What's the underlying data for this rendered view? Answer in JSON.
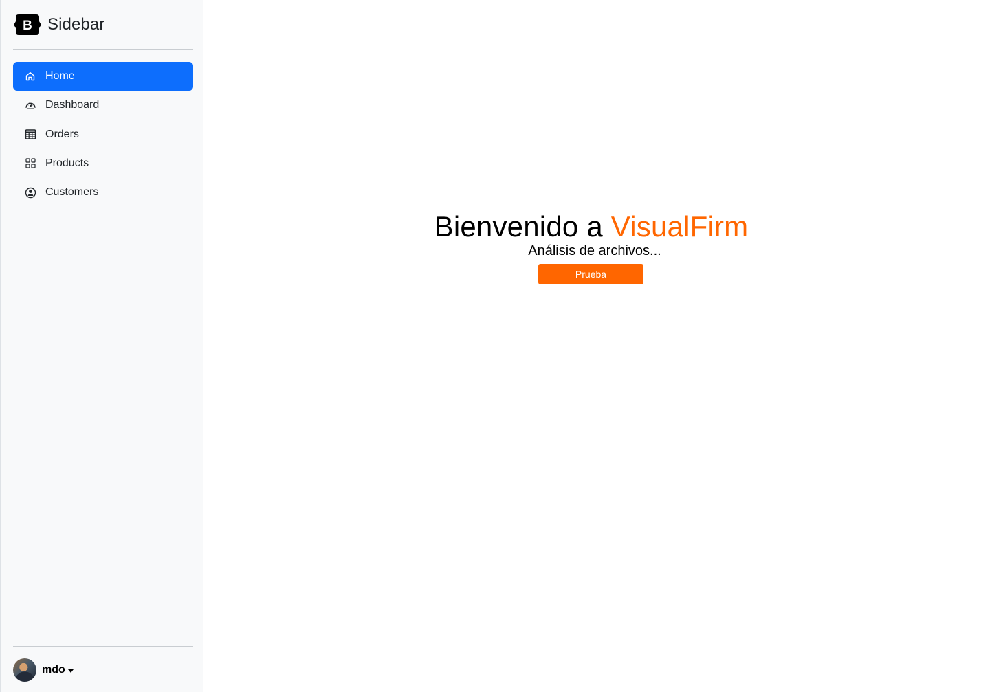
{
  "sidebar": {
    "brand": {
      "logo_letter": "B",
      "title": "Sidebar"
    },
    "items": [
      {
        "label": "Home",
        "icon": "home-icon",
        "active": true
      },
      {
        "label": "Dashboard",
        "icon": "speedometer-icon",
        "active": false
      },
      {
        "label": "Orders",
        "icon": "table-icon",
        "active": false
      },
      {
        "label": "Products",
        "icon": "grid-icon",
        "active": false
      },
      {
        "label": "Customers",
        "icon": "person-circle-icon",
        "active": false
      }
    ],
    "user": {
      "name": "mdo",
      "avatar": "user-avatar",
      "dropdown_icon": "caret-down-icon"
    }
  },
  "main": {
    "hero": {
      "title_prefix": "Bienvenido a",
      "brand_name": "VisualFirm",
      "subtitle": "Análisis de archivos...",
      "button_label": "Prueba"
    }
  },
  "colors": {
    "sidebar_background": "#f8f9fa",
    "active_nav_background": "#0d6efd",
    "brand_accent": "#ff6600",
    "text_dark": "#212529",
    "main_background": "#ffffff"
  }
}
